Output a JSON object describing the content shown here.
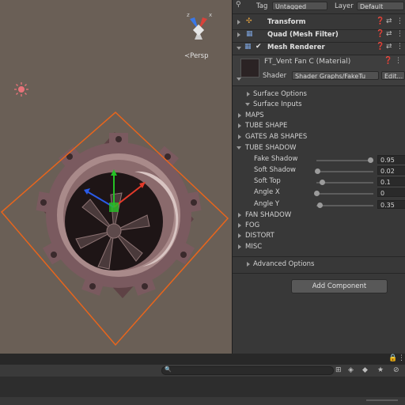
{
  "scene": {
    "persp_label": "≺Persp",
    "gizmo_axes": {
      "x": "x",
      "z": "z"
    }
  },
  "header": {
    "tag_label": "Tag",
    "tag_value": "Untagged",
    "layer_label": "Layer",
    "layer_value": "Default"
  },
  "components": [
    {
      "name": "Transform",
      "icon": "transform-icon"
    },
    {
      "name": "Quad (Mesh Filter)",
      "icon": "grid-icon"
    },
    {
      "name": "Mesh Renderer",
      "icon": "mesh-renderer-icon",
      "enabled": true
    }
  ],
  "material": {
    "name": "FT_Vent Fan C (Material)",
    "shader_label": "Shader",
    "shader_value": "Shader Graphs/FakeTu",
    "edit_label": "Edit..."
  },
  "sections": {
    "surface_options": "Surface Options",
    "surface_inputs": "Surface Inputs",
    "maps": "MAPS",
    "tube_shape": "TUBE SHAPE",
    "gates_ab": "GATES AB SHAPES",
    "tube_shadow": "TUBE SHADOW",
    "fan_shadow": "FAN SHADOW",
    "fog": "FOG",
    "distort": "DISTORT",
    "misc": "MISC",
    "advanced": "Advanced Options"
  },
  "tube_shadow_props": [
    {
      "label": "Fake Shadow",
      "value": "0.95",
      "fraction": 0.95
    },
    {
      "label": "Soft Shadow",
      "value": "0.02",
      "fraction": 0.02
    },
    {
      "label": "Soft Top",
      "value": "0.1",
      "fraction": 0.1
    },
    {
      "label": "Angle X",
      "value": "0",
      "fraction": 0.0
    },
    {
      "label": "Angle Y",
      "value": "0.35",
      "fraction": 0.06
    }
  ],
  "add_component_label": "Add Component",
  "colors": {
    "scene_bg": "#6a5f56",
    "selection_outline": "#e8651c",
    "inspector_bg": "#383838"
  }
}
